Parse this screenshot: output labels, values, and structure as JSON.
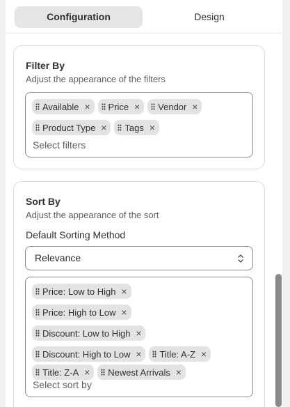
{
  "tabs": [
    {
      "label": "Configuration",
      "active": true
    },
    {
      "label": "Design",
      "active": false
    }
  ],
  "filter_card": {
    "title": "Filter By",
    "subtitle": "Adjust the appearance of the filters",
    "tags": [
      "Available",
      "Price",
      "Vendor",
      "Product Type",
      "Tags"
    ],
    "placeholder": "Select filters"
  },
  "sort_card": {
    "title": "Sort By",
    "subtitle": "Adjust the appearance of the sort",
    "default_label": "Default Sorting Method",
    "default_value": "Relevance",
    "tags": [
      "Price: Low to High",
      "Price: High to Low",
      "Discount: Low to High",
      "Discount: High to Low",
      "Title: A-Z",
      "Title: Z-A",
      "Newest Arrivals"
    ],
    "placeholder": "Select sort by"
  },
  "icons": {
    "drag": "drag-handle-icon",
    "remove": "close-icon",
    "select": "chevron-up-down-icon"
  }
}
